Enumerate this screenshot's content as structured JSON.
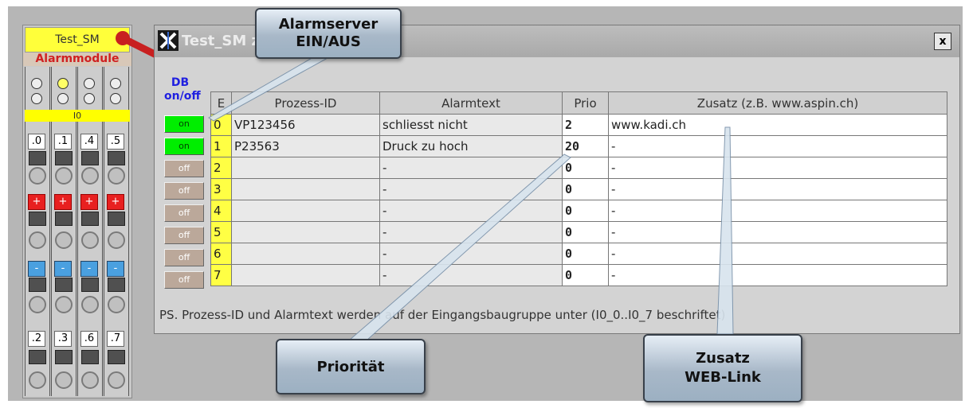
{
  "module": {
    "title": "Test_SM",
    "subtitle": "Alarmmodule",
    "input_label": "I0",
    "labels_top": [
      ".0",
      ".1",
      ".4",
      ".5"
    ],
    "labels_bottom": [
      ".2",
      ".3",
      ".6",
      ".7"
    ],
    "plus": "+",
    "minus": "-"
  },
  "window": {
    "title_visible": "Test_SM zu",
    "close": "x",
    "db_label_top": "DB",
    "db_label_bottom": "on/off",
    "columns": [
      "E",
      "Prozess-ID",
      "Alarmtext",
      "Prio",
      "Zusatz (z.B. www.aspin.ch)"
    ],
    "rows": [
      {
        "toggle": "on",
        "e": "0",
        "pid": "VP123456",
        "text": "schliesst nicht",
        "prio": "2",
        "zusatz": "www.kadi.ch"
      },
      {
        "toggle": "on",
        "e": "1",
        "pid": "P23563",
        "text": "Druck zu hoch",
        "prio": "20",
        "zusatz": "-"
      },
      {
        "toggle": "off",
        "e": "2",
        "pid": "",
        "text": "-",
        "prio": "0",
        "zusatz": "-"
      },
      {
        "toggle": "off",
        "e": "3",
        "pid": "",
        "text": "-",
        "prio": "0",
        "zusatz": "-"
      },
      {
        "toggle": "off",
        "e": "4",
        "pid": "",
        "text": "-",
        "prio": "0",
        "zusatz": "-"
      },
      {
        "toggle": "off",
        "e": "5",
        "pid": "",
        "text": "-",
        "prio": "0",
        "zusatz": "-"
      },
      {
        "toggle": "off",
        "e": "6",
        "pid": "",
        "text": "-",
        "prio": "0",
        "zusatz": "-"
      },
      {
        "toggle": "off",
        "e": "7",
        "pid": "",
        "text": "-",
        "prio": "0",
        "zusatz": "-"
      }
    ],
    "footer": "PS. Prozess-ID und Alarmtext werden auf der Eingangsbaugruppe unter (I0_0..I0_7 beschriftet)"
  },
  "callouts": {
    "alarmserver": [
      "Alarmserver",
      "EIN/AUS"
    ],
    "prioritaet": "Priorität",
    "zusatz": [
      "Zusatz",
      "WEB-Link"
    ]
  },
  "colors": {
    "on": "#00ee00",
    "off": "#bba89a",
    "e_column": "#ffff44",
    "db_label": "#2020e0",
    "module_header": "#ffff3a"
  }
}
